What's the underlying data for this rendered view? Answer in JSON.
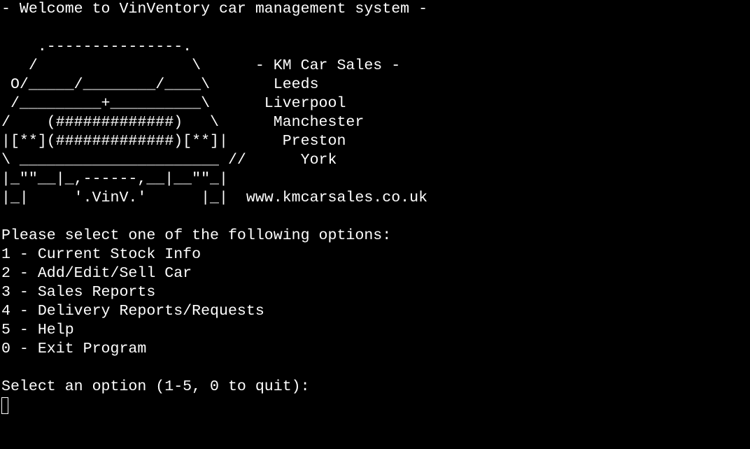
{
  "header": {
    "welcome": "- Welcome to VinVentory car management system -"
  },
  "banner": {
    "lines": [
      "",
      "    .---------------.",
      "   /                 \\      - KM Car Sales -",
      " O/_____/________/____\\       Leeds",
      " /_________+__________\\      Liverpool",
      "/    (#############)   \\      Manchester",
      "|[**](#############)[**]|      Preston",
      "\\ ______________________ //      York",
      "|_\"\"__|_,------,__|__\"\"_|",
      "|_|     '.VinV.'      |_|  www.kmcarsales.co.uk"
    ]
  },
  "menu": {
    "prompt_heading": "Please select one of the following options:",
    "options": [
      "1 - Current Stock Info",
      "2 - Add/Edit/Sell Car",
      "3 - Sales Reports",
      "4 - Delivery Reports/Requests",
      "5 - Help",
      "0 - Exit Program"
    ]
  },
  "input": {
    "prompt": "Select an option (1-5, 0 to quit):",
    "value": ""
  },
  "colors": {
    "background": "#000000",
    "foreground": "#ffffff"
  }
}
